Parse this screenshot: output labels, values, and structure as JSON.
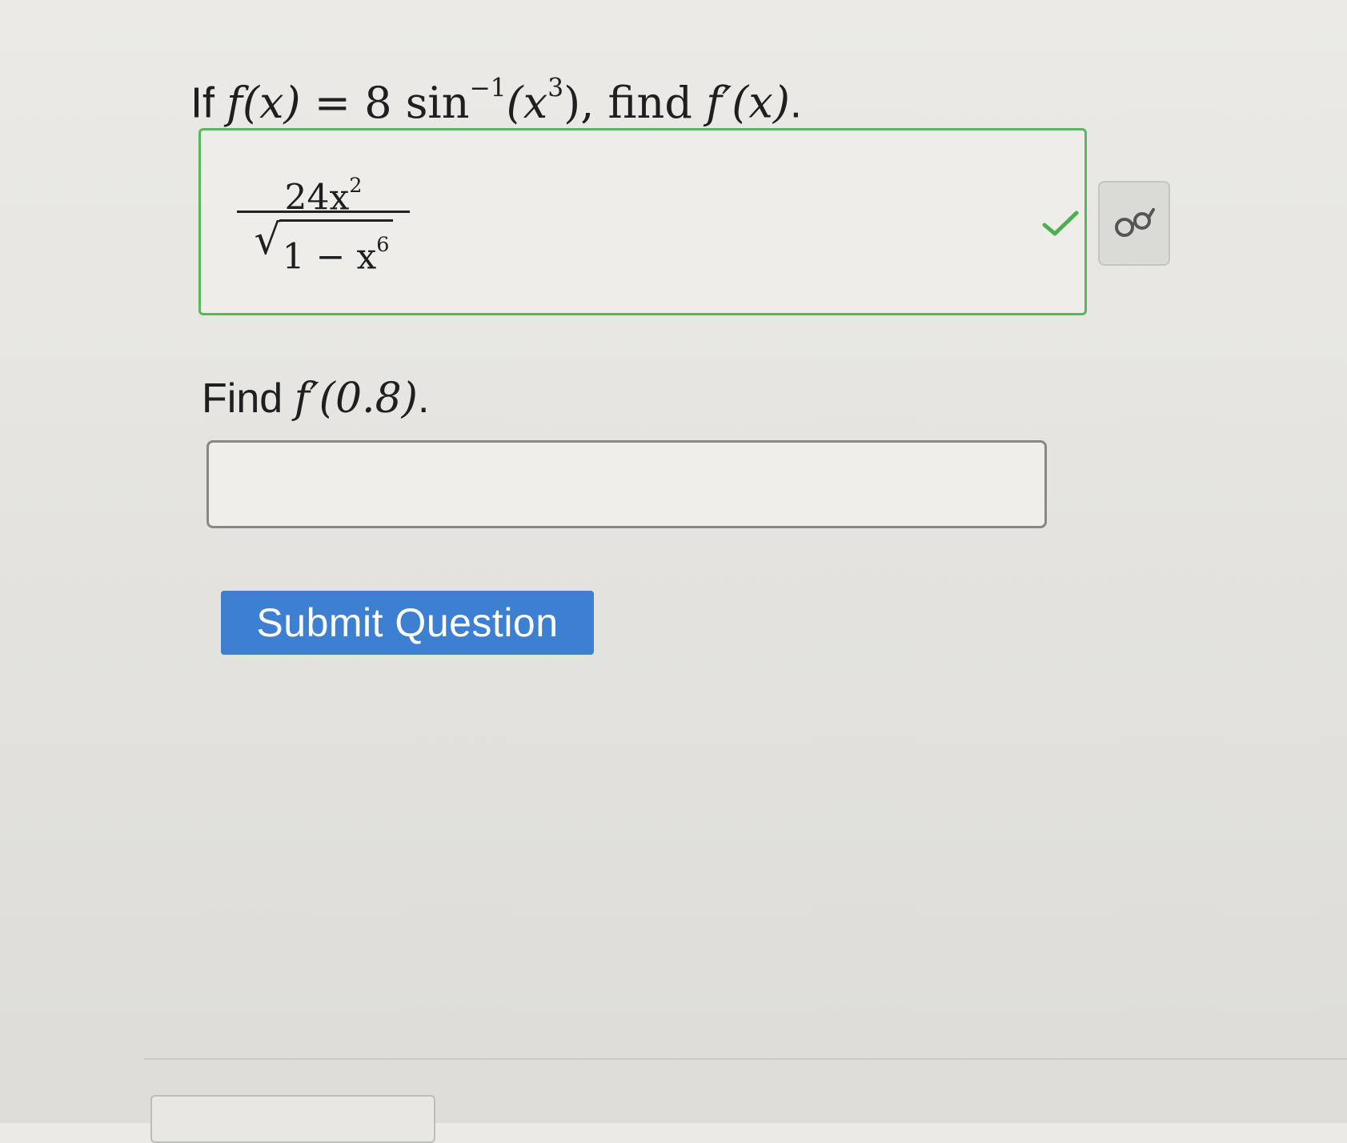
{
  "question": {
    "intro": "If",
    "f_of_x": "f(x)",
    "equals": "= 8 sin",
    "inverse_exponent": "−1",
    "arg_open": "(x",
    "arg_exponent": "3",
    "arg_close": "), find",
    "target": "f′(x)",
    "period": "."
  },
  "answer1": {
    "numerator_base": "24x",
    "numerator_exponent": "2",
    "radical_symbol": "√",
    "denominator_base": "1 − x",
    "denominator_exponent": "6",
    "status": "correct",
    "status_color": "#5bb55f"
  },
  "preview_icon": "preview-glasses-icon",
  "question2": {
    "label": "Find",
    "expression": "f′(0.8)",
    "period": "."
  },
  "answer2": {
    "value": "",
    "placeholder": ""
  },
  "submit": {
    "label": "Submit Question",
    "color": "#3d7fd0"
  }
}
